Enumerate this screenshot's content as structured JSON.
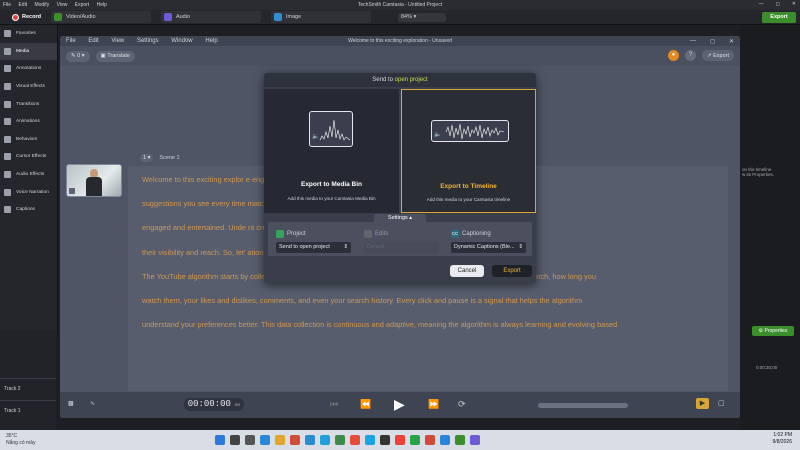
{
  "app": {
    "title": "TechSmith Camtasia - Untitled Project",
    "menu": [
      "File",
      "Edit",
      "Modify",
      "View",
      "Export",
      "Help"
    ],
    "record_label": "Record",
    "media_tabs": [
      {
        "label": "Video/Audio",
        "color": "#3a8f2b"
      },
      {
        "label": "Audio",
        "color": "#6b5bd6"
      },
      {
        "label": "Image",
        "color": "#2f8dd4"
      }
    ],
    "zoom": "84%",
    "export_label": "Export",
    "nav": [
      "Favorites",
      "Media",
      "Annotations",
      "Visual Effects",
      "Transitions",
      "Animations",
      "Behaviors",
      "Cursor Effects",
      "Audio Effects",
      "Voice Narration",
      "Captions"
    ],
    "tracks": [
      "Track 2",
      "Track 1"
    ],
    "properties_label": "Properties",
    "side_hint": "on the timeline\nw its Properties.",
    "timecode": "0:00:30;00"
  },
  "inner": {
    "menu": [
      "File",
      "Edit",
      "View",
      "Settings",
      "Window",
      "Help"
    ],
    "title": "Welcome to this exciting exploration - Unsaved",
    "version_badge": "0",
    "translate_label": "Translate",
    "export_label": "Export",
    "scene_num": "1",
    "scene_label": "Scene 1",
    "time": "00:00:00",
    "time_suffix": "ms",
    "transcript": [
      "Welcome to this exciting explor                                                                                   e engine behind the personalized video",
      "suggestions you see every time                                                                                 matches their interests, keeping them",
      "engaged and entertained. Unde                                                                                 nt creators and marketers aiming to boost",
      "their visibility and reach. So, let'                                                                                  ations so effective and dynamic.",
      "The YouTube algorithm starts by collecting vast amounts of data from user interactions. This includes what videos you watch, how long you",
      "watch them, your likes and dislikes, comments, and even your search history. Every click and pause is a signal that helps the algorithm",
      "understand your preferences better. This data collection is continuous and adaptive, meaning the algorithm is always learning and evolving based"
    ]
  },
  "modal": {
    "title_prefix": "Send to ",
    "title_highlight": "open project",
    "options": [
      {
        "name": "Export to Media Bin",
        "desc": "Add this media to your Camtasia Media Bin"
      },
      {
        "name": "Export to Timeline",
        "desc": "Add this media to your Camtasia timeline"
      }
    ],
    "settings_label": "Settings ▴",
    "project": {
      "label": "Project",
      "value": "Send to open project"
    },
    "edits": {
      "label": "Edits",
      "value": "Default"
    },
    "captioning": {
      "label": "Captioning",
      "icon": "CC",
      "value": "Dynamic Captions (Ble..."
    },
    "cancel": "Cancel",
    "export": "Export",
    "accent": "#f0b52f"
  },
  "taskbar": {
    "temp": "35°C",
    "weather": "Nắng có mây",
    "time": "1:02 PM",
    "date": "9/8/2026"
  }
}
